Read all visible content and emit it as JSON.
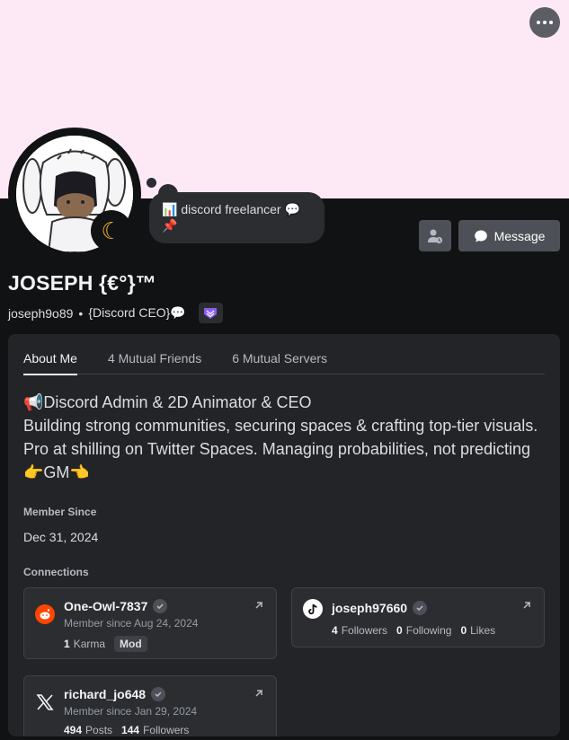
{
  "header": {
    "more_label": "More options"
  },
  "profile": {
    "status_bubble": "📊 discord freelancer 💬 📌",
    "display_name": "JOSEPH {€°}™",
    "username": "joseph9o89",
    "separator": "•",
    "pronouns": "{Discord CEO}💬",
    "message_button": "Message"
  },
  "tabs": [
    {
      "label": "About Me"
    },
    {
      "label": "4 Mutual Friends"
    },
    {
      "label": "6 Mutual Servers"
    }
  ],
  "about": {
    "bio_line1": "📢Discord Admin & 2D Animator & CEO",
    "bio_rest": "Building strong communities, securing spaces & crafting top-tier visuals. Pro at shilling on Twitter Spaces. Managing probabilities, not predicting 👉GM👈",
    "member_since_title": "Member Since",
    "member_since": "Dec 31, 2024",
    "connections_title": "Connections"
  },
  "connections": [
    {
      "platform_icon": "reddit-icon",
      "name": "One-Owl-7837",
      "since": "Member since Aug 24, 2024",
      "karma_value": "1",
      "karma_label": "Karma",
      "mod_label": "Mod"
    },
    {
      "platform_icon": "tiktok-icon",
      "name": "joseph97660",
      "followers_value": "4",
      "followers_label": "Followers",
      "following_value": "0",
      "following_label": "Following",
      "likes_value": "0",
      "likes_label": "Likes"
    },
    {
      "platform_icon": "x-icon",
      "name": "richard_jo648",
      "since": "Member since Jan 29, 2024",
      "posts_value": "494",
      "posts_label": "Posts",
      "followers_value": "144",
      "followers_label": "Followers"
    }
  ],
  "colors": {
    "banner": "#fde9f5",
    "background": "#111214",
    "panel": "#232428",
    "status_idle": "#f0b232",
    "reddit": "#ff4500"
  }
}
